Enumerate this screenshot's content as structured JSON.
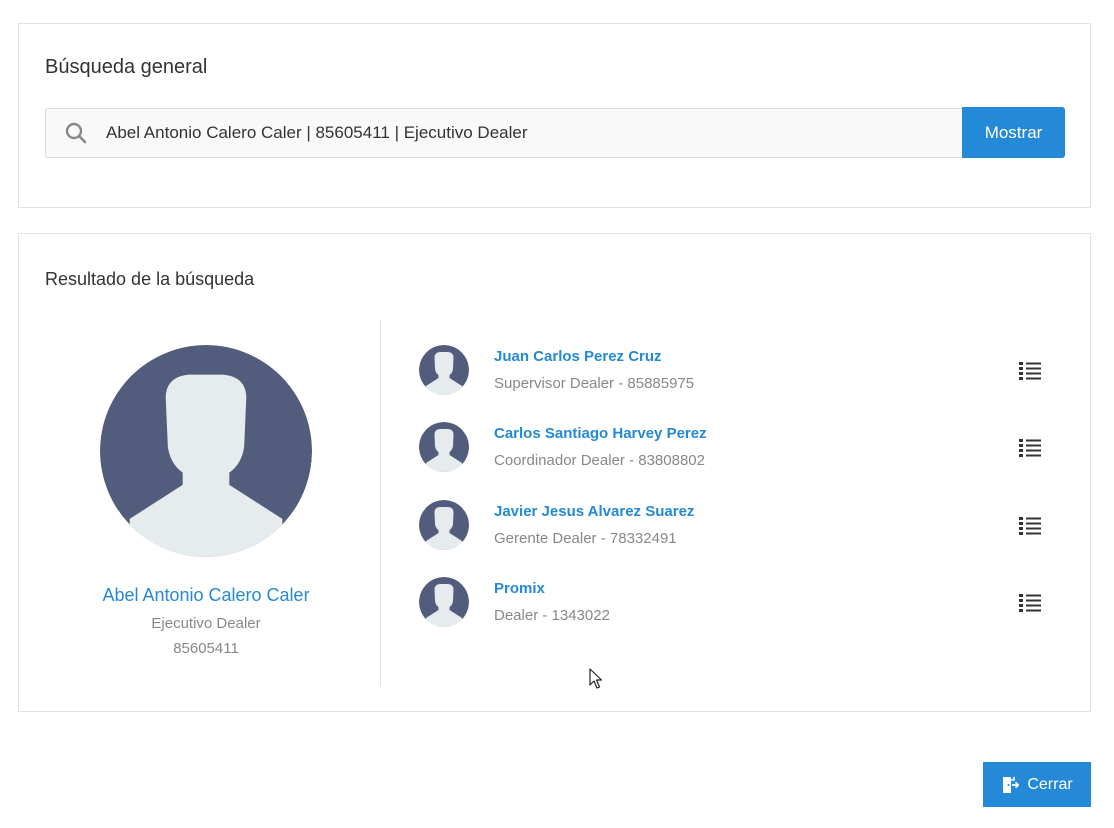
{
  "search": {
    "title": "Búsqueda general",
    "value": "Abel Antonio Calero Caler | 85605411 | Ejecutivo Dealer",
    "icon": "search-icon",
    "button_label": "Mostrar"
  },
  "results": {
    "title": "Resultado de la búsqueda",
    "main": {
      "name": "Abel Antonio Calero Caler",
      "role": "Ejecutivo Dealer",
      "code": "85605411"
    },
    "people": [
      {
        "name": "Juan Carlos Perez Cruz",
        "desc": "Supervisor Dealer - 85885975"
      },
      {
        "name": "Carlos Santiago Harvey Perez",
        "desc": "Coordinador Dealer - 83808802"
      },
      {
        "name": "Javier Jesus Alvarez Suarez",
        "desc": "Gerente Dealer - 78332491"
      },
      {
        "name": "Promix",
        "desc": "Dealer - 1343022"
      }
    ]
  },
  "footer": {
    "close_label": "Cerrar",
    "close_icon": "exit-door-icon"
  },
  "colors": {
    "accent": "#2489d6",
    "avatar_bg": "#525d7d",
    "avatar_fg": "#e6ebed"
  }
}
